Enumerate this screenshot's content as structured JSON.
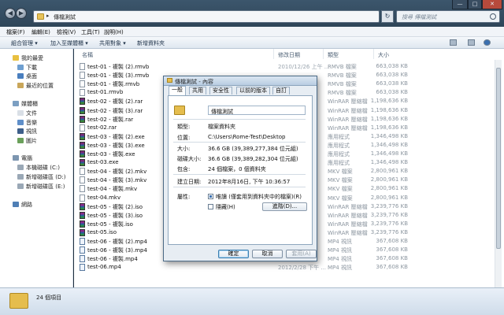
{
  "address": {
    "path": "傳檔測試"
  },
  "search": {
    "placeholder": "搜尋 傳檔測試"
  },
  "menu": [
    "檔案(F)",
    "編輯(E)",
    "檢視(V)",
    "工具(T)",
    "說明(H)"
  ],
  "toolbar": [
    "組合管理 ▾",
    "加入至媒體櫃 ▾",
    "共用對象 ▾",
    "新增資料夾"
  ],
  "columns": {
    "name": "名稱",
    "date": "修改日期",
    "type": "類型",
    "size": "大小"
  },
  "nav": {
    "favorites": "我的最愛",
    "downloads": "下載",
    "desktop": "桌面",
    "recent": "最近的位置",
    "libraries": "媒體櫃",
    "documents": "文件",
    "music": "音樂",
    "videos": "視訊",
    "pictures": "圖片",
    "computer": "電腦",
    "drive_c": "本機磁碟 (C:)",
    "drive_d": "新增磁碟區 (D:)",
    "drive_e": "新增磁碟區 (E:)",
    "network": "網路"
  },
  "files": [
    {
      "name": "test-01 - 複製 (2).rmvb",
      "date": "2010/12/26 上午 ...",
      "type": "RMVB 檔案",
      "size": "663,038 KB",
      "kind": "plain"
    },
    {
      "name": "test-01 - 複製 (3).rmvb",
      "date": "",
      "type": "RMVB 檔案",
      "size": "663,038 KB",
      "kind": "plain"
    },
    {
      "name": "test-01 - 複製.rmvb",
      "date": "",
      "type": "RMVB 檔案",
      "size": "663,038 KB",
      "kind": "plain"
    },
    {
      "name": "test-01.rmvb",
      "date": "",
      "type": "RMVB 檔案",
      "size": "663,038 KB",
      "kind": "plain"
    },
    {
      "name": "test-02 - 複製 (2).rar",
      "date": "",
      "type": "WinRAR 壓縮檔",
      "size": "1,198,636 KB",
      "kind": "rar"
    },
    {
      "name": "test-02 - 複製 (3).rar",
      "date": "",
      "type": "WinRAR 壓縮檔",
      "size": "1,198,636 KB",
      "kind": "rar"
    },
    {
      "name": "test-02 - 複製.rar",
      "date": "",
      "type": "WinRAR 壓縮檔",
      "size": "1,198,636 KB",
      "kind": "rar"
    },
    {
      "name": "test-02.rar",
      "date": "",
      "type": "WinRAR 壓縮檔",
      "size": "1,198,636 KB",
      "kind": "plain"
    },
    {
      "name": "test-03 - 複製 (2).exe",
      "date": "",
      "type": "應用程式",
      "size": "1,346,498 KB",
      "kind": "exe"
    },
    {
      "name": "test-03 - 複製 (3).exe",
      "date": "",
      "type": "應用程式",
      "size": "1,346,498 KB",
      "kind": "exe"
    },
    {
      "name": "test-03 - 複製.exe",
      "date": "",
      "type": "應用程式",
      "size": "1,346,498 KB",
      "kind": "exe"
    },
    {
      "name": "test-03.exe",
      "date": "",
      "type": "應用程式",
      "size": "1,346,498 KB",
      "kind": "exe"
    },
    {
      "name": "test-04 - 複製 (2).mkv",
      "date": "",
      "type": "MKV 檔案",
      "size": "2,800,961 KB",
      "kind": "plain"
    },
    {
      "name": "test-04 - 複製 (3).mkv",
      "date": "",
      "type": "MKV 檔案",
      "size": "2,800,961 KB",
      "kind": "plain"
    },
    {
      "name": "test-04 - 複製.mkv",
      "date": "",
      "type": "MKV 檔案",
      "size": "2,800,961 KB",
      "kind": "plain"
    },
    {
      "name": "test-04.mkv",
      "date": "",
      "type": "MKV 檔案",
      "size": "2,800,961 KB",
      "kind": "plain"
    },
    {
      "name": "test-05 - 複製 (2).iso",
      "date": "",
      "type": "WinRAR 壓縮檔",
      "size": "3,239,776 KB",
      "kind": "iso"
    },
    {
      "name": "test-05 - 複製 (3).iso",
      "date": "",
      "type": "WinRAR 壓縮檔",
      "size": "3,239,776 KB",
      "kind": "iso"
    },
    {
      "name": "test-05 - 複製.iso",
      "date": "",
      "type": "WinRAR 壓縮檔",
      "size": "3,239,776 KB",
      "kind": "iso"
    },
    {
      "name": "test-05.iso",
      "date": "",
      "type": "WinRAR 壓縮檔",
      "size": "3,239,776 KB",
      "kind": "iso"
    },
    {
      "name": "test-06 - 複製 (2).mp4",
      "date": "",
      "type": "MP4 視訊",
      "size": "367,608 KB",
      "kind": "mp4"
    },
    {
      "name": "test-06 - 複製 (3).mp4",
      "date": "",
      "type": "MP4 視訊",
      "size": "367,608 KB",
      "kind": "mp4"
    },
    {
      "name": "test-06 - 複製.mp4",
      "date": "",
      "type": "MP4 視訊",
      "size": "367,608 KB",
      "kind": "mp4"
    },
    {
      "name": "test-06.mp4",
      "date": "2012/2/28 下午 ...",
      "type": "MP4 視訊",
      "size": "367,608 KB",
      "kind": "mp4"
    }
  ],
  "status": {
    "count": "24 個項目"
  },
  "dialog": {
    "title": "傳檔測試 - 內容",
    "tabs": [
      "一般",
      "共用",
      "安全性",
      "以前的版本",
      "自訂"
    ],
    "name": "傳檔測試",
    "props": [
      {
        "label": "類型:",
        "value": "檔案資料夾"
      },
      {
        "label": "位置:",
        "value": "C:\\Users\\Rome-Test\\Desktop"
      },
      {
        "label": "大小:",
        "value": "36.6 GB (39,389,277,384 位元組)"
      },
      {
        "label": "磁碟大小:",
        "value": "36.6 GB (39,389,282,304 位元組)"
      },
      {
        "label": "包含:",
        "value": "24 個檔案，0 個資料夾"
      }
    ],
    "created": {
      "label": "建立日期:",
      "value": "2012年8月16日, 下午 10:36:57"
    },
    "attributes": {
      "label": "屬性:",
      "readonly": "唯讀 (僅套用到資料夾中的檔案)(R)",
      "hidden": "隱藏(H)",
      "advanced": "進階(D)..."
    },
    "buttons": {
      "ok": "確定",
      "cancel": "取消",
      "apply": "套用(A)"
    }
  }
}
